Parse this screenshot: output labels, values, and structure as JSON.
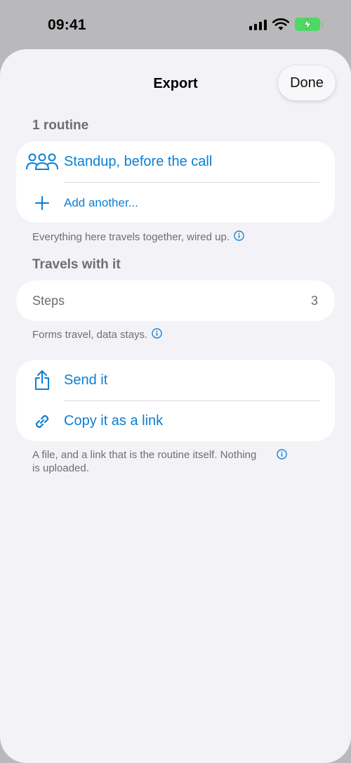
{
  "status_bar": {
    "time": "09:41"
  },
  "nav": {
    "title": "Export",
    "done_label": "Done"
  },
  "routines": {
    "header": "1 routine",
    "items": [
      {
        "label": "Standup, before the call",
        "icon": "people-group-icon"
      }
    ],
    "add_label": "Add another...",
    "footnote": "Everything here travels together, wired up."
  },
  "travels": {
    "header": "Travels with it",
    "rows": [
      {
        "label": "Steps",
        "value": "3"
      }
    ],
    "footnote": "Forms travel, data stays."
  },
  "actions": {
    "items": [
      {
        "label": "Send it",
        "icon": "share-icon"
      },
      {
        "label": "Copy it as a link",
        "icon": "link-icon"
      }
    ],
    "footnote_line1": "A file, and a link that is the routine itself. Nothing",
    "footnote_line2": "is uploaded."
  },
  "colors": {
    "accent": "#0a7fd6",
    "background": "#f2f2f7",
    "card": "#ffffff",
    "battery": "#4cd964"
  }
}
